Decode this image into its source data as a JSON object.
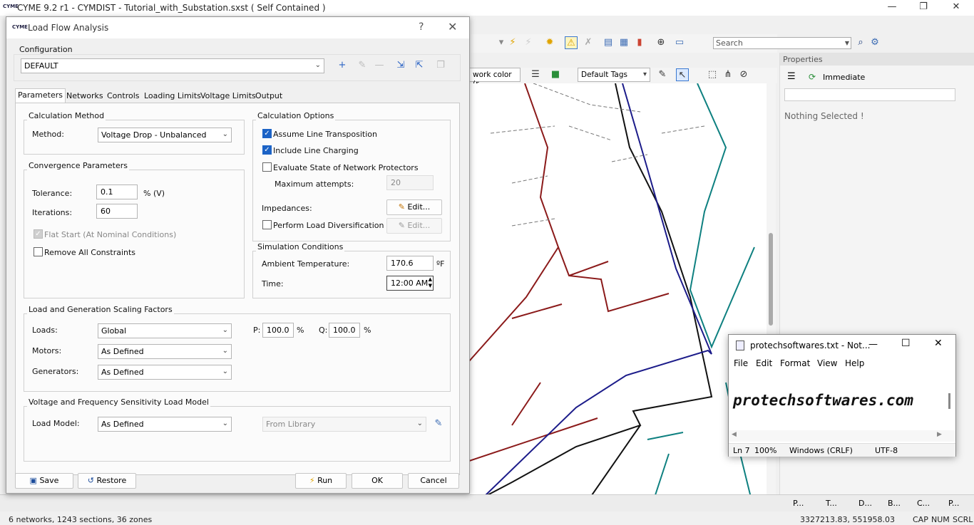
{
  "app": {
    "title": "CYME 9.2 r1 - CYMDIST - Tutorial_with_Substation.sxst ( Self Contained )",
    "logo": "CYME",
    "search_placeholder": "Search",
    "map_toolbar": {
      "color_by": "work color (r",
      "tags": "Default Tags"
    }
  },
  "properties": {
    "title": "Properties",
    "mode": "Immediate",
    "nothing_selected": "Nothing Selected !"
  },
  "bottom_tabs": [
    "P...",
    "T...",
    "D...",
    "B...",
    "C...",
    "P..."
  ],
  "status": {
    "left": "6 networks, 1243 sections, 36 zones",
    "coords": "3327213.83, 551958.03",
    "caps": "CAP",
    "num": "NUM",
    "scrl": "SCRL"
  },
  "dialog": {
    "title": "Load Flow Analysis",
    "help": "?",
    "configuration_label": "Configuration",
    "configuration_value": "DEFAULT",
    "tabs": [
      "Parameters",
      "Networks",
      "Controls",
      "Loading Limits",
      "Voltage Limits",
      "Output"
    ],
    "active_tab": "Parameters",
    "calc_method": {
      "group": "Calculation Method",
      "method_label": "Method:",
      "method_value": "Voltage Drop - Unbalanced"
    },
    "convergence": {
      "group": "Convergence Parameters",
      "tolerance_label": "Tolerance:",
      "tolerance_value": "0.1",
      "tolerance_unit": "% (V)",
      "iterations_label": "Iterations:",
      "iterations_value": "60",
      "flat_start": "Flat Start (At Nominal Conditions)",
      "remove_constraints": "Remove All Constraints"
    },
    "calc_options": {
      "group": "Calculation Options",
      "assume_transposition": "Assume Line Transposition",
      "include_charging": "Include Line Charging",
      "evaluate_protectors": "Evaluate State of Network Protectors",
      "max_attempts_label": "Maximum attempts:",
      "max_attempts_value": "20",
      "impedances_label": "Impedances:",
      "edit_label": "Edit...",
      "load_diversification": "Perform Load Diversification"
    },
    "simulation": {
      "group": "Simulation Conditions",
      "ambient_label": "Ambient Temperature:",
      "ambient_value": "170.6",
      "ambient_unit": "ºF",
      "time_label": "Time:",
      "time_value": "12:00 AM"
    },
    "scaling": {
      "group": "Load and Generation Scaling Factors",
      "loads_label": "Loads:",
      "loads_value": "Global",
      "motors_label": "Motors:",
      "motors_value": "As Defined",
      "generators_label": "Generators:",
      "generators_value": "As Defined",
      "p_label": "P:",
      "p_value": "100.0",
      "q_label": "Q:",
      "q_value": "100.0",
      "pct": "%"
    },
    "sensitivity": {
      "group": "Voltage and Frequency Sensitivity Load Model",
      "load_model_label": "Load Model:",
      "load_model_value": "As Defined",
      "library_value": "From Library"
    },
    "buttons": {
      "save": "Save",
      "restore": "Restore",
      "run": "Run",
      "ok": "OK",
      "cancel": "Cancel"
    }
  },
  "notepad": {
    "title": "protechsoftwares.txt - Not...",
    "menu": [
      "File",
      "Edit",
      "Format",
      "View",
      "Help"
    ],
    "content": "protechsoftwares.com",
    "status_ln": "Ln 7",
    "zoom": "100%",
    "eol": "Windows (CRLF)",
    "encoding": "UTF-8"
  }
}
